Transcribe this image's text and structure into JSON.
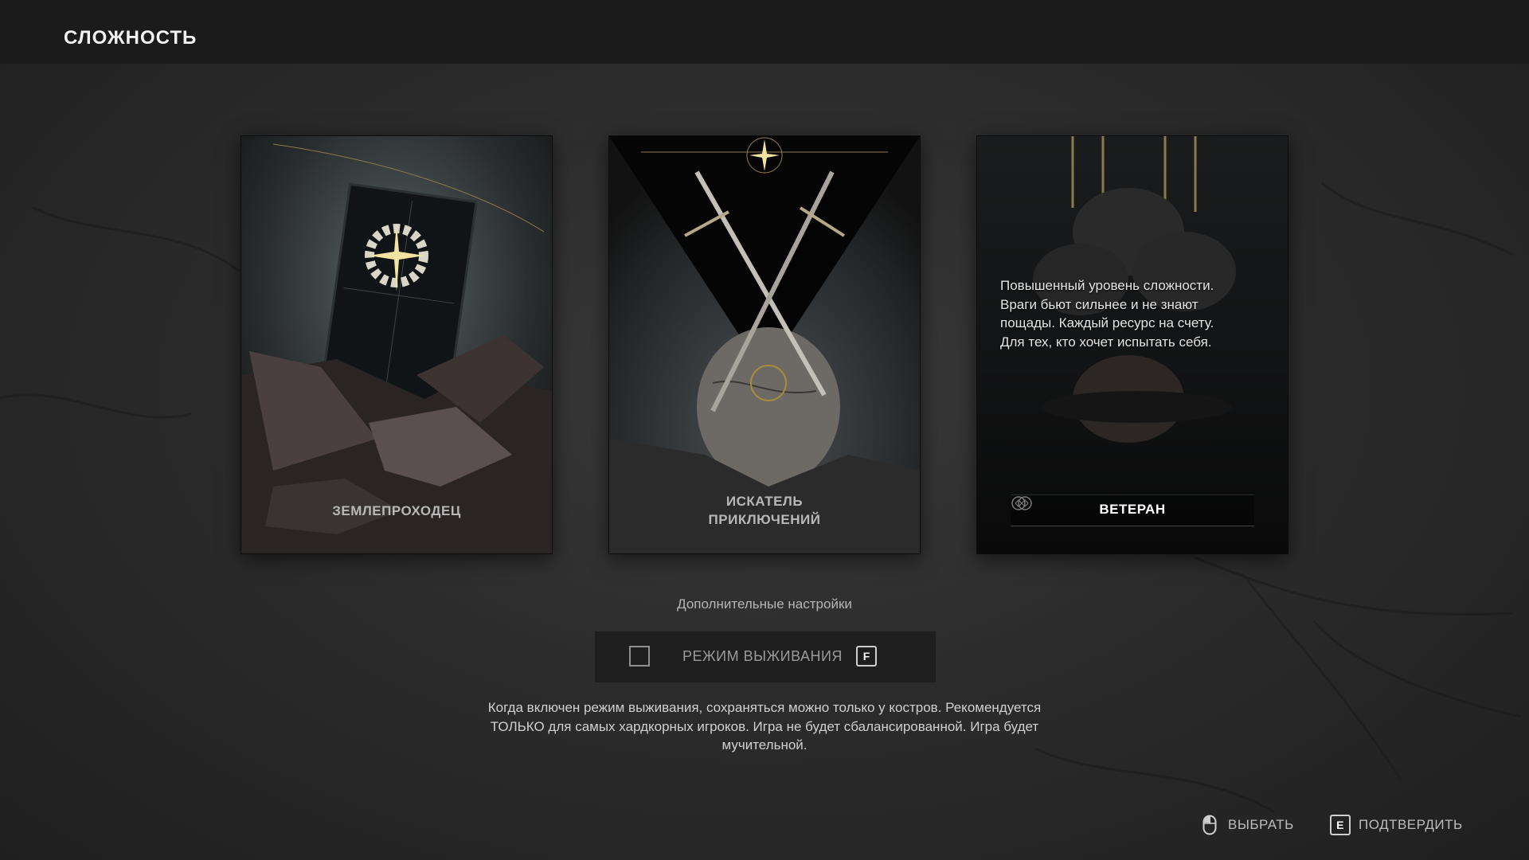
{
  "header": {
    "title": "СЛОЖНОСТЬ"
  },
  "cards": [
    {
      "name": "ЗЕМЛЕПРОХОДЕЦ",
      "selected": false
    },
    {
      "name": "ИСКАТЕЛЬ ПРИКЛЮЧЕНИЙ",
      "name_line1": "ИСКАТЕЛЬ",
      "name_line2": "ПРИКЛЮЧЕНИЙ",
      "selected": false
    },
    {
      "name": "ВЕТЕРАН",
      "selected": true,
      "description": [
        "Повышенный уровень сложности.",
        "Враги бьют сильнее и не знают",
        "пощады. Каждый ресурс на счету.",
        "Для тех, кто хочет испытать себя."
      ]
    }
  ],
  "extra_settings": {
    "label": "Дополнительные настройки"
  },
  "survival": {
    "label": "РЕЖИМ ВЫЖИВАНИЯ",
    "key": "F",
    "checked": false
  },
  "note": [
    "Когда включен режим выживания, сохраняться можно только у костров. Рекомендуется",
    "ТОЛЬКО для самых хардкорных игроков. Игра не будет сбалансированной. Игра будет",
    "мучительной."
  ],
  "footer": {
    "select": {
      "label": "ВЫБРАТЬ",
      "icon": "mouse-icon"
    },
    "confirm": {
      "label": "ПОДТВЕРДИТЬ",
      "key": "E"
    }
  },
  "colors": {
    "background": "#2c2c2c",
    "topbar": "#1b1b1b",
    "accent_gold": "#c9b27a"
  }
}
